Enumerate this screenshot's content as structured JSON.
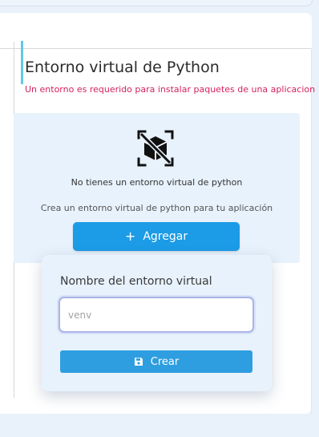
{
  "section": {
    "title": "Entorno virtual de Python",
    "subtitle": "Un entorno es requerido para instalar paquetes de una aplicacion"
  },
  "empty_state": {
    "icon": "no-box-icon",
    "title": "No tienes un entorno virtual de python",
    "description": "Crea un entorno virtual de python para tu aplicación",
    "add_button": {
      "icon": "plus-icon",
      "label": "Agregar"
    }
  },
  "create_form": {
    "field_label": "Nombre del entorno virtual",
    "input_value": "",
    "input_placeholder": "venv",
    "create_button": {
      "icon": "save-icon",
      "label": "Crear"
    }
  },
  "colors": {
    "accent": "#1c9be6",
    "subtitle": "#d6215b",
    "section_border": "#62c7e3",
    "panel_bg": "#e8f2fc"
  }
}
